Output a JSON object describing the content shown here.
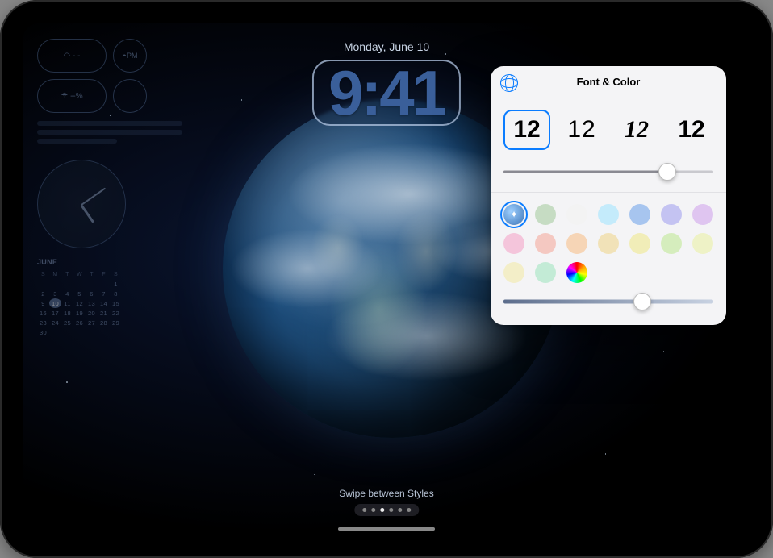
{
  "date_label": "Monday, June 10",
  "clock_time": "9:41",
  "swipe_hint": "Swipe between Styles",
  "page_dots": {
    "count": 6,
    "active_index": 2
  },
  "left_widgets": {
    "mini": [
      {
        "icon": "gauge",
        "value": "- -"
      },
      {
        "icon": "sunset",
        "value": "PM"
      },
      {
        "icon": "umbrella",
        "value": "--%"
      },
      {
        "icon": "circle",
        "value": ""
      }
    ],
    "calendar": {
      "month_label": "JUNE",
      "weekdays": [
        "S",
        "M",
        "T",
        "W",
        "T",
        "F",
        "S"
      ],
      "first_weekday": 6,
      "days_in_month": 30,
      "today": 10
    }
  },
  "popover": {
    "title": "Font & Color",
    "font_options": [
      {
        "sample": "12",
        "style": "rounded",
        "selected": true
      },
      {
        "sample": "12",
        "style": "light",
        "selected": false
      },
      {
        "sample": "12",
        "style": "serif-italic",
        "selected": false
      },
      {
        "sample": "12",
        "style": "heavy",
        "selected": false
      }
    ],
    "weight_slider": {
      "min": 0,
      "max": 100,
      "value": 78
    },
    "color_swatches": [
      {
        "id": "vibrant",
        "hex": "#3a72b5",
        "selected": true,
        "special": "vibrant"
      },
      {
        "id": "sage",
        "hex": "#c6dcc3",
        "selected": false
      },
      {
        "id": "white",
        "hex": "#f3f3f3",
        "selected": false
      },
      {
        "id": "sky",
        "hex": "#c4ebfb",
        "selected": false
      },
      {
        "id": "blue",
        "hex": "#a7c5ef",
        "selected": false
      },
      {
        "id": "periwinkle",
        "hex": "#c4c3f2",
        "selected": false
      },
      {
        "id": "lavender",
        "hex": "#dfc5f0",
        "selected": false
      },
      {
        "id": "pink",
        "hex": "#f4c5db",
        "selected": false
      },
      {
        "id": "blush",
        "hex": "#f4c8c1",
        "selected": false
      },
      {
        "id": "peach",
        "hex": "#f6d5b6",
        "selected": false
      },
      {
        "id": "sand",
        "hex": "#f1e2b8",
        "selected": false
      },
      {
        "id": "lemon",
        "hex": "#f1edb8",
        "selected": false
      },
      {
        "id": "mint",
        "hex": "#d5edbd",
        "selected": false
      },
      {
        "id": "butter",
        "hex": "#eef2c6",
        "selected": false
      },
      {
        "id": "cream",
        "hex": "#f3eec8",
        "selected": false
      },
      {
        "id": "seafoam",
        "hex": "#c3ebd6",
        "selected": false
      },
      {
        "id": "rainbow",
        "hex": "",
        "selected": false,
        "special": "rainbow"
      }
    ],
    "tint_slider": {
      "min": 0,
      "max": 100,
      "value": 66,
      "track_gradient": [
        "#5c6d8c",
        "#c8d2e2"
      ]
    }
  }
}
